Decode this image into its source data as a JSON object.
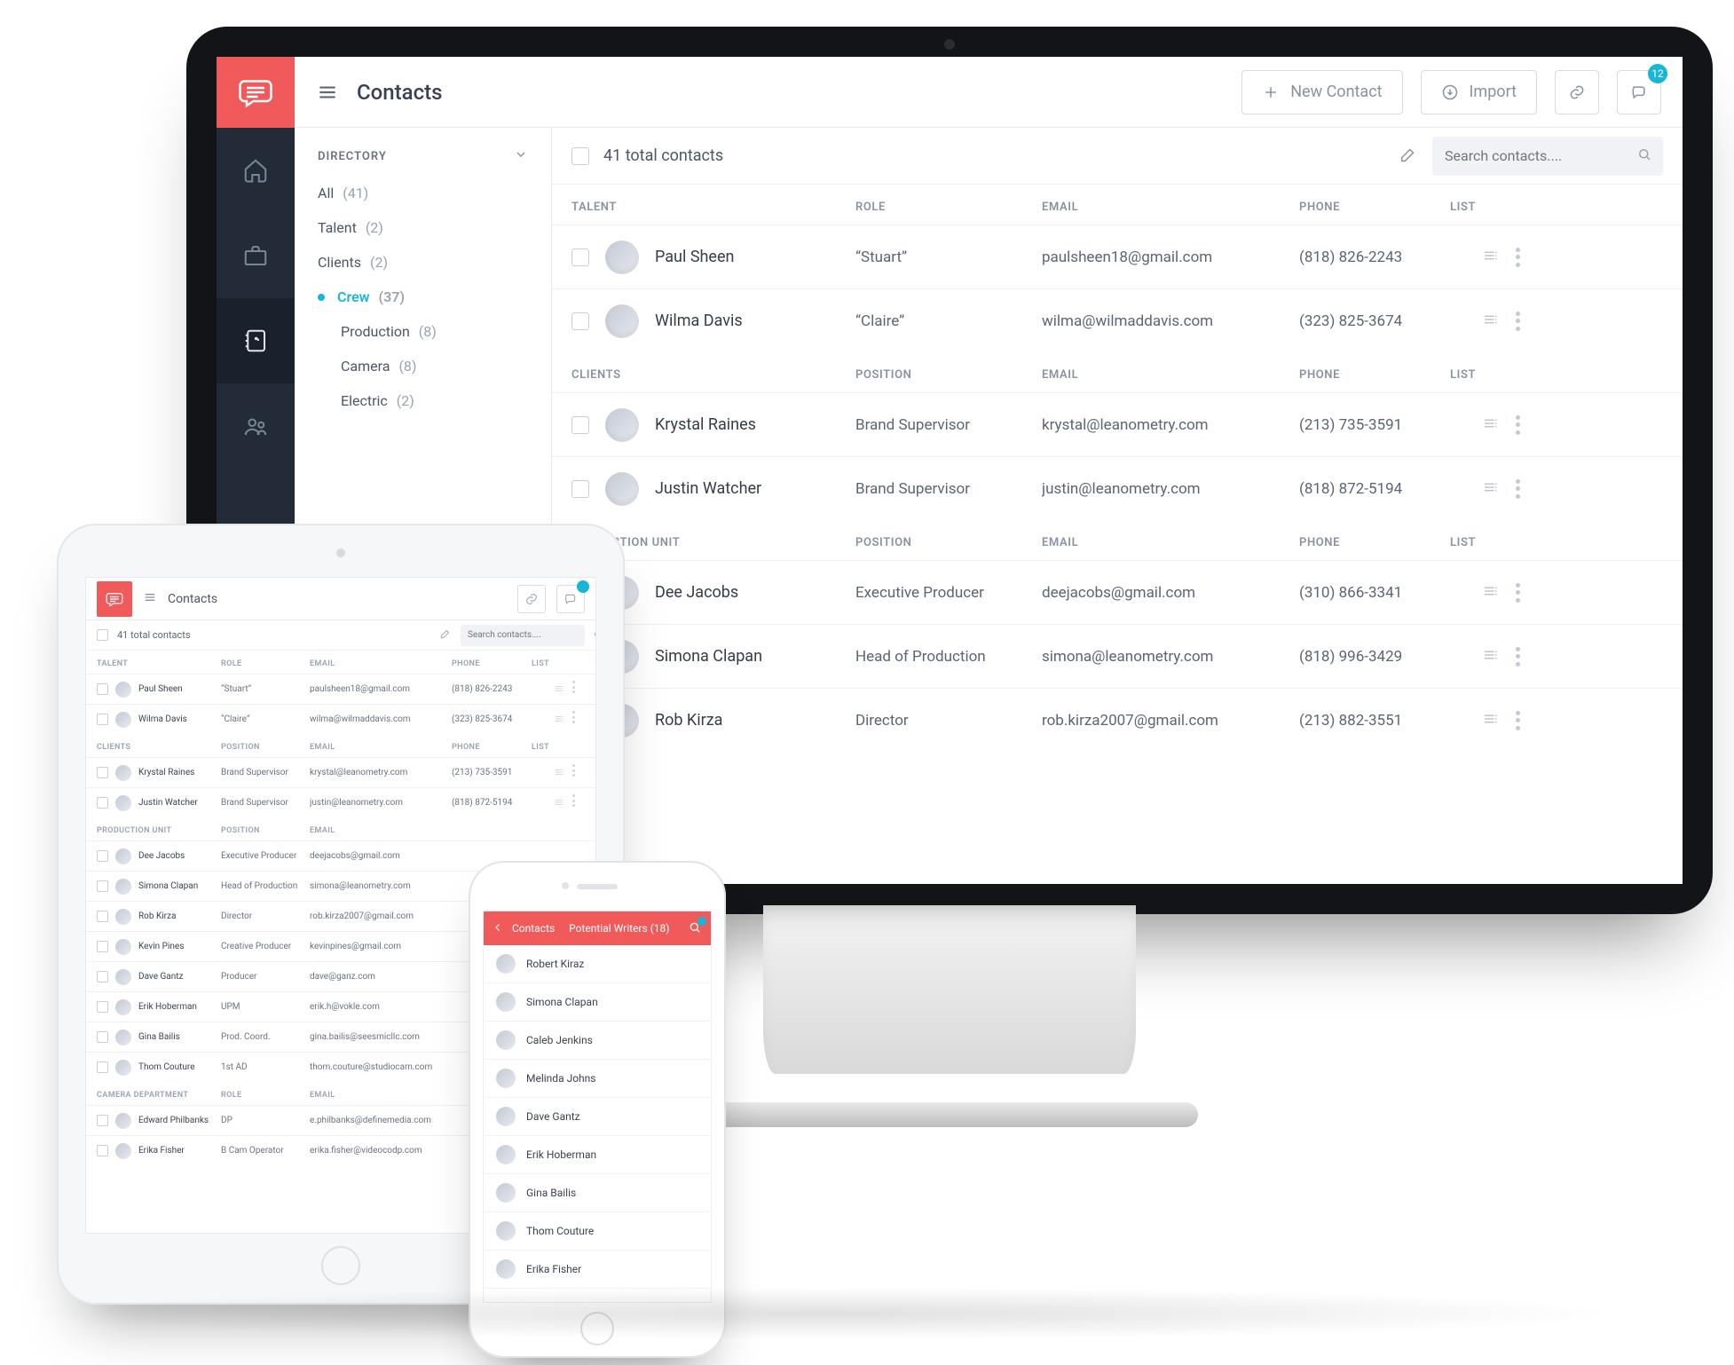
{
  "colors": {
    "accent": "#f05a5a",
    "link": "#17b6d8",
    "rail": "#242b38"
  },
  "desktop": {
    "page_title": "Contacts",
    "buttons": {
      "new_contact": "New Contact",
      "import": "Import"
    },
    "chat_badge": "12",
    "total_contacts": "41 total contacts",
    "search_placeholder": "Search contacts....",
    "directory": {
      "header": "DIRECTORY",
      "items": [
        {
          "label": "All",
          "count": "(41)"
        },
        {
          "label": "Talent",
          "count": "(2)"
        },
        {
          "label": "Clients",
          "count": "(2)"
        },
        {
          "label": "Crew",
          "count": "(37)",
          "active": true
        },
        {
          "label": "Production",
          "count": "(8)",
          "indent": true
        },
        {
          "label": "Camera",
          "count": "(8)",
          "indent": true
        },
        {
          "label": "Electric",
          "count": "(2)",
          "indent": true
        }
      ]
    },
    "groups": [
      {
        "title": "TALENT",
        "columns": [
          "ROLE",
          "EMAIL",
          "PHONE",
          "LIST"
        ],
        "rows": [
          {
            "name": "Paul Sheen",
            "role": "“Stuart”",
            "email": "paulsheen18@gmail.com",
            "phone": "(818) 826-2243"
          },
          {
            "name": "Wilma Davis",
            "role": "“Claire”",
            "email": "wilma@wilmaddavis.com",
            "phone": "(323) 825-3674"
          }
        ]
      },
      {
        "title": "CLIENTS",
        "columns": [
          "POSITION",
          "EMAIL",
          "PHONE",
          "LIST"
        ],
        "rows": [
          {
            "name": "Krystal Raines",
            "role": "Brand Supervisor",
            "email": "krystal@leanometry.com",
            "phone": "(213) 735-3591"
          },
          {
            "name": "Justin Watcher",
            "role": "Brand Supervisor",
            "email": "justin@leanometry.com",
            "phone": "(818) 872-5194"
          }
        ]
      },
      {
        "title": "PRODUCTION UNIT",
        "columns": [
          "POSITION",
          "EMAIL",
          "PHONE",
          "LIST"
        ],
        "rows": [
          {
            "name": "Dee Jacobs",
            "role": "Executive Producer",
            "email": "deejacobs@gmail.com",
            "phone": "(310) 866-3341"
          },
          {
            "name": "Simona Clapan",
            "role": "Head of Production",
            "email": "simona@leanometry.com",
            "phone": "(818) 996-3429"
          },
          {
            "name": "Rob Kirza",
            "role": "Director",
            "email": "rob.kirza2007@gmail.com",
            "phone": "(213) 882-3551"
          }
        ]
      }
    ]
  },
  "tablet": {
    "page_title": "Contacts",
    "total_contacts": "41 total contacts",
    "search_placeholder": "Search contacts....",
    "groups": [
      {
        "title": "TALENT",
        "columns": [
          "ROLE",
          "EMAIL",
          "PHONE",
          "LIST"
        ],
        "cols": 5,
        "rows": [
          {
            "name": "Paul Sheen",
            "role": "“Stuart”",
            "email": "paulsheen18@gmail.com",
            "phone": "(818) 826-2243"
          },
          {
            "name": "Wilma Davis",
            "role": "“Claire”",
            "email": "wilma@wilmaddavis.com",
            "phone": "(323) 825-3674"
          }
        ]
      },
      {
        "title": "CLIENTS",
        "columns": [
          "POSITION",
          "EMAIL",
          "PHONE",
          "LIST"
        ],
        "cols": 5,
        "rows": [
          {
            "name": "Krystal Raines",
            "role": "Brand Supervisor",
            "email": "krystal@leanometry.com",
            "phone": "(213) 735-3591"
          },
          {
            "name": "Justin Watcher",
            "role": "Brand Supervisor",
            "email": "justin@leanometry.com",
            "phone": "(818) 872-5194"
          }
        ]
      },
      {
        "title": "PRODUCTION UNIT",
        "columns": [
          "POSITION",
          "EMAIL"
        ],
        "cols": 3,
        "rows": [
          {
            "name": "Dee Jacobs",
            "role": "Executive Producer",
            "email": "deejacobs@gmail.com"
          },
          {
            "name": "Simona Clapan",
            "role": "Head of Production",
            "email": "simona@leanometry.com"
          },
          {
            "name": "Rob Kirza",
            "role": "Director",
            "email": "rob.kirza2007@gmail.com"
          },
          {
            "name": "Kevin Pines",
            "role": "Creative Producer",
            "email": "kevinpines@gmail.com"
          },
          {
            "name": "Dave Gantz",
            "role": "Producer",
            "email": "dave@ganz.com"
          },
          {
            "name": "Erik Hoberman",
            "role": "UPM",
            "email": "erik.h@vokle.com"
          },
          {
            "name": "Gina Bailis",
            "role": "Prod. Coord.",
            "email": "gina.bailis@seesmicllc.com"
          },
          {
            "name": "Thom Couture",
            "role": "1st AD",
            "email": "thom.couture@studiocam.com"
          }
        ]
      },
      {
        "title": "CAMERA DEPARTMENT",
        "columns": [
          "ROLE",
          "EMAIL"
        ],
        "cols": 3,
        "rows": [
          {
            "name": "Edward Philbanks",
            "role": "DP",
            "email": "e.philbanks@definemedia.com"
          },
          {
            "name": "Erika Fisher",
            "role": "B Cam Operator",
            "email": "erika.fisher@videocodp.com"
          }
        ]
      }
    ]
  },
  "phone": {
    "back_label": "Contacts",
    "title": "Potential Writers (18)",
    "rows": [
      "Robert Kiraz",
      "Simona Clapan",
      "Caleb Jenkins",
      "Melinda Johns",
      "Dave Gantz",
      "Erik Hoberman",
      "Gina Bailis",
      "Thom Couture",
      "Erika Fisher"
    ]
  }
}
